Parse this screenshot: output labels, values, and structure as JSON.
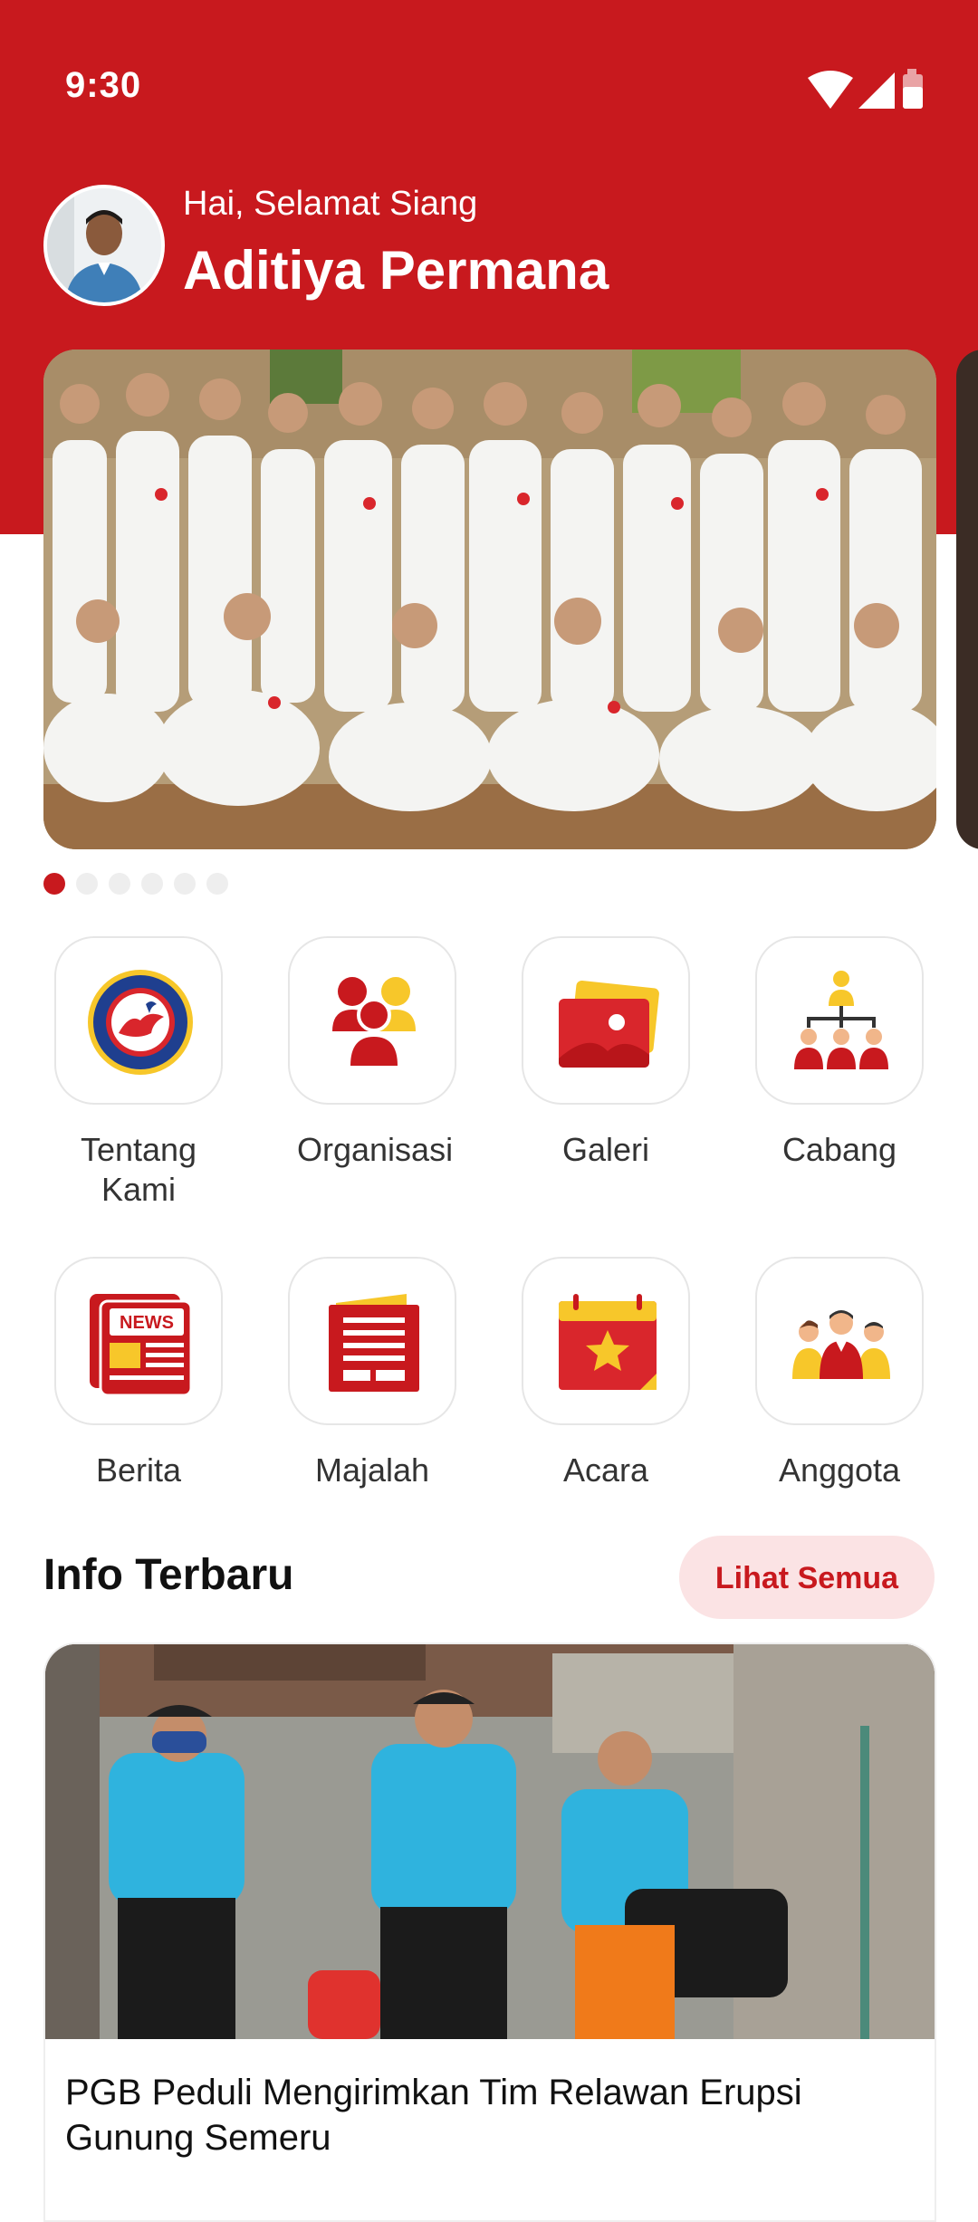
{
  "status_bar": {
    "time": "9:30"
  },
  "profile": {
    "greeting": "Hai, Selamat Siang",
    "name": "Aditiya Permana"
  },
  "banner": {
    "slide_count": 6,
    "active_index": 0
  },
  "menu": [
    {
      "label": "Tentang Kami",
      "icon": "organization-logo-icon"
    },
    {
      "label": "Organisasi",
      "icon": "people-group-icon"
    },
    {
      "label": "Galeri",
      "icon": "gallery-icon"
    },
    {
      "label": "Cabang",
      "icon": "branch-hierarchy-icon"
    },
    {
      "label": "Berita",
      "icon": "news-icon"
    },
    {
      "label": "Majalah",
      "icon": "magazine-icon"
    },
    {
      "label": "Acara",
      "icon": "calendar-event-icon"
    },
    {
      "label": "Anggota",
      "icon": "members-icon"
    }
  ],
  "info": {
    "title": "Info Terbaru",
    "see_all_label": "Lihat Semua",
    "news": [
      {
        "title": "PGB Peduli Mengirimkan Tim Relawan Erupsi Gunung Semeru"
      }
    ]
  },
  "colors": {
    "primary": "#C8191E",
    "accent_yellow": "#F7C72A",
    "pill_bg": "#FBE3E4"
  }
}
